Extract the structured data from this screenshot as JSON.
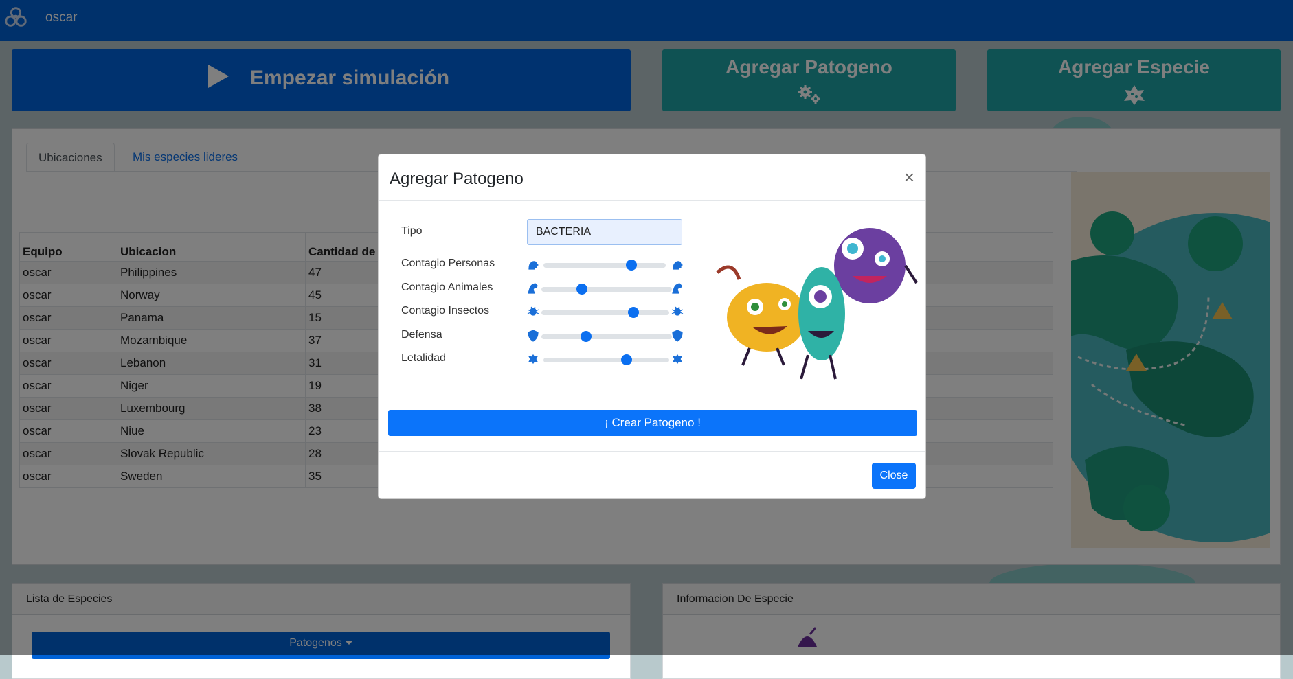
{
  "navbar": {
    "brand_name": "oscar"
  },
  "actions": {
    "start_label": "Empezar simulación",
    "add_pathogen_label": "Agregar Patogeno",
    "add_species_label": "Agregar Especie"
  },
  "tabs": [
    {
      "label": "Ubicaciones",
      "active": true
    },
    {
      "label": "Mis especies lideres",
      "active": false
    }
  ],
  "locations_table": {
    "headers": [
      "Equipo",
      "Ubicacion",
      "Cantidad de v"
    ],
    "rows": [
      [
        "oscar",
        "Philippines",
        "47"
      ],
      [
        "oscar",
        "Norway",
        "45"
      ],
      [
        "oscar",
        "Panama",
        "15"
      ],
      [
        "oscar",
        "Mozambique",
        "37"
      ],
      [
        "oscar",
        "Lebanon",
        "31"
      ],
      [
        "oscar",
        "Niger",
        "19"
      ],
      [
        "oscar",
        "Luxembourg",
        "38"
      ],
      [
        "oscar",
        "Niue",
        "23"
      ],
      [
        "oscar",
        "Slovak Republic",
        "28"
      ],
      [
        "oscar",
        "Sweden",
        "35"
      ]
    ]
  },
  "species_list": {
    "title": "Lista de Especies",
    "dropdown_label": "Patogenos"
  },
  "species_info": {
    "title": "Informacion De Especie"
  },
  "modal": {
    "title": "Agregar Patogeno",
    "close_symbol": "×",
    "tipo_label": "Tipo",
    "tipo_value": "BACTERIA",
    "sliders": [
      {
        "label": "Contagio Personas",
        "value": 0.72
      },
      {
        "label": "Contagio Animales",
        "value": 0.31
      },
      {
        "label": "Contagio Insectos",
        "value": 0.72
      },
      {
        "label": "Defensa",
        "value": 0.34
      },
      {
        "label": "Letalidad",
        "value": 0.66
      }
    ],
    "create_label": "¡ Crear Patogeno !",
    "close_label": "Close"
  },
  "colors": {
    "primary": "#0062d6",
    "teal": "#1fa5a6",
    "slider_thumb": "#0b6ff0",
    "icon_blue": "#1a6fd8"
  }
}
